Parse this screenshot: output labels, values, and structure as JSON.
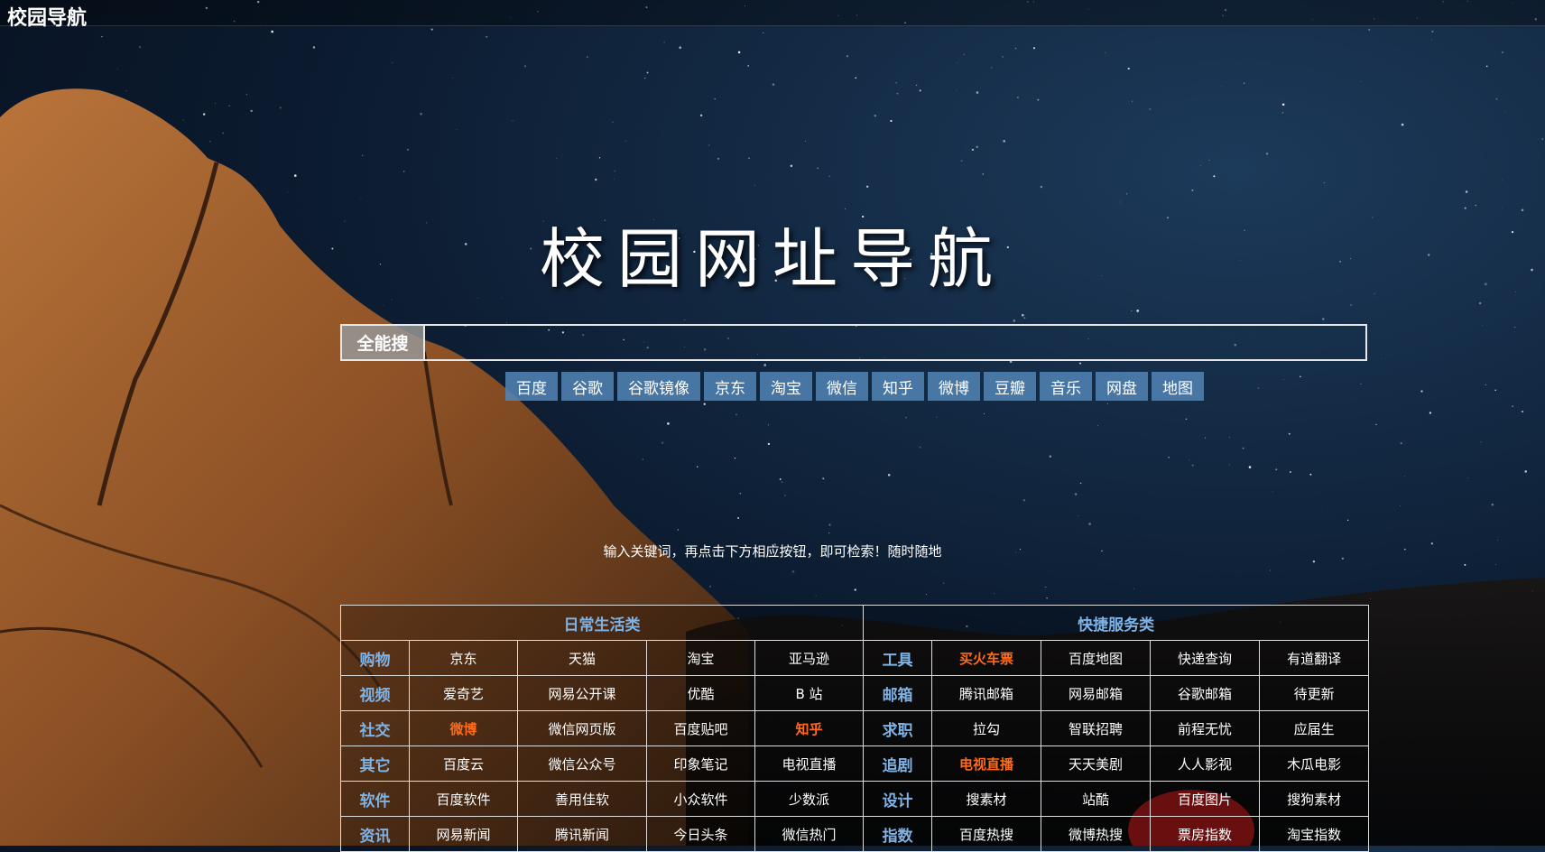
{
  "brand": "校园导航",
  "title": "校园网址导航",
  "search": {
    "label": "全能搜",
    "value": "",
    "placeholder": ""
  },
  "engines": [
    "百度",
    "谷歌",
    "谷歌镜像",
    "京东",
    "淘宝",
    "微信",
    "知乎",
    "微博",
    "豆瓣",
    "音乐",
    "网盘",
    "地图"
  ],
  "hint": "输入关键词，再点击下方相应按钮，即可检索！随时随地",
  "colors": {
    "category": "#7fb3e6",
    "hot": "#ff6a1a",
    "engine_bg": "#5285b6"
  },
  "sections": [
    {
      "title": "日常生活类",
      "rows": [
        {
          "cat": "购物",
          "links": [
            {
              "t": "京东"
            },
            {
              "t": "天猫"
            },
            {
              "t": "淘宝"
            },
            {
              "t": "亚马逊"
            }
          ]
        },
        {
          "cat": "视频",
          "links": [
            {
              "t": "爱奇艺"
            },
            {
              "t": "网易公开课"
            },
            {
              "t": "优酷"
            },
            {
              "t": "B 站"
            }
          ]
        },
        {
          "cat": "社交",
          "links": [
            {
              "t": "微博",
              "hot": true
            },
            {
              "t": "微信网页版"
            },
            {
              "t": "百度贴吧"
            },
            {
              "t": "知乎",
              "hot": true
            }
          ]
        },
        {
          "cat": "其它",
          "links": [
            {
              "t": "百度云"
            },
            {
              "t": "微信公众号"
            },
            {
              "t": "印象笔记"
            },
            {
              "t": "电视直播"
            }
          ]
        },
        {
          "cat": "软件",
          "links": [
            {
              "t": "百度软件"
            },
            {
              "t": "善用佳软"
            },
            {
              "t": "小众软件"
            },
            {
              "t": "少数派"
            }
          ]
        },
        {
          "cat": "资讯",
          "links": [
            {
              "t": "网易新闻"
            },
            {
              "t": "腾讯新闻"
            },
            {
              "t": "今日头条"
            },
            {
              "t": "微信热门"
            }
          ]
        }
      ]
    },
    {
      "title": "快捷服务类",
      "rows": [
        {
          "cat": "工具",
          "links": [
            {
              "t": "买火车票",
              "hot": true
            },
            {
              "t": "百度地图"
            },
            {
              "t": "快递查询"
            },
            {
              "t": "有道翻译"
            }
          ]
        },
        {
          "cat": "邮箱",
          "links": [
            {
              "t": "腾讯邮箱"
            },
            {
              "t": "网易邮箱"
            },
            {
              "t": "谷歌邮箱"
            },
            {
              "t": "待更新"
            }
          ]
        },
        {
          "cat": "求职",
          "links": [
            {
              "t": "拉勾"
            },
            {
              "t": "智联招聘"
            },
            {
              "t": "前程无忧"
            },
            {
              "t": "应届生"
            }
          ]
        },
        {
          "cat": "追剧",
          "links": [
            {
              "t": "电视直播",
              "hot": true
            },
            {
              "t": "天天美剧"
            },
            {
              "t": "人人影视"
            },
            {
              "t": "木瓜电影"
            }
          ]
        },
        {
          "cat": "设计",
          "links": [
            {
              "t": "搜素材"
            },
            {
              "t": "站酷"
            },
            {
              "t": "百度图片"
            },
            {
              "t": "搜狗素材"
            }
          ]
        },
        {
          "cat": "指数",
          "links": [
            {
              "t": "百度热搜"
            },
            {
              "t": "微博热搜"
            },
            {
              "t": "票房指数"
            },
            {
              "t": "淘宝指数"
            }
          ]
        }
      ]
    }
  ]
}
